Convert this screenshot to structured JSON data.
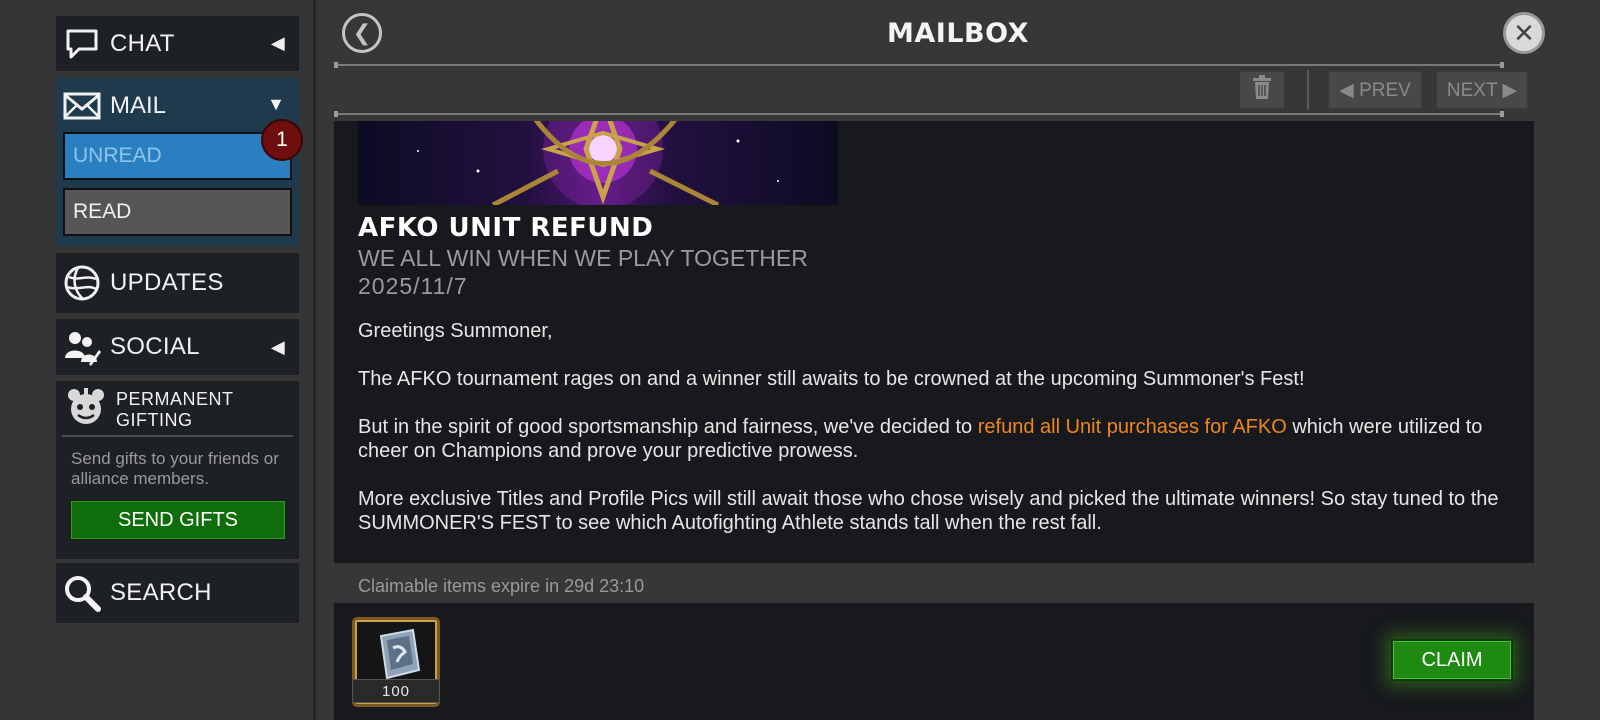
{
  "sidebar": {
    "chat": {
      "label": "CHAT",
      "icon": "chat-bubble-icon"
    },
    "mail": {
      "label": "MAIL",
      "icon": "envelope-icon",
      "unread_label": "UNREAD",
      "read_label": "READ",
      "unread_count": "1"
    },
    "updates": {
      "label": "UPDATES",
      "icon": "globe-icon"
    },
    "social": {
      "label": "SOCIAL",
      "icon": "people-icon"
    },
    "gifting": {
      "title": "PERMANENT GIFTING",
      "description": "Send gifts to your friends or alliance members.",
      "button_label": "SEND GIFTS",
      "icon": "gift-mascot-icon"
    },
    "search": {
      "label": "SEARCH",
      "icon": "search-icon"
    }
  },
  "header": {
    "title": "MAILBOX",
    "prev_label": "◀ PREV",
    "next_label": "NEXT ▶"
  },
  "message": {
    "title": "AFKO UNIT REFUND",
    "subtitle": "WE ALL WIN WHEN WE PLAY TOGETHER",
    "date": "2025/11/7",
    "greeting": "Greetings Summoner,",
    "p1": "The AFKO tournament rages on and a winner still awaits to be crowned at the upcoming Summoner's Fest!",
    "p2_before": "But in the spirit of good sportsmanship and fairness, we've decided to ",
    "p2_highlight": "refund all Unit purchases for AFKO",
    "p2_after": " which were utilized to cheer on Champions and prove your predictive prowess.",
    "p3": "More exclusive Titles and Profile Pics will still await those who chose wisely and picked the ultimate winners! So stay tuned to the SUMMONER'S FEST to see which Autofighting Athlete stands tall when the rest fall."
  },
  "rewards": {
    "expire_text": "Claimable items expire in 29d 23:10",
    "item_count": "100",
    "item_icon": "unit-card-icon",
    "claim_label": "CLAIM"
  },
  "colors": {
    "highlight": "#f0871b",
    "unread_tab": "#2a7fc1",
    "badge": "#6e0e0e",
    "green_button": "#1f8a11"
  }
}
